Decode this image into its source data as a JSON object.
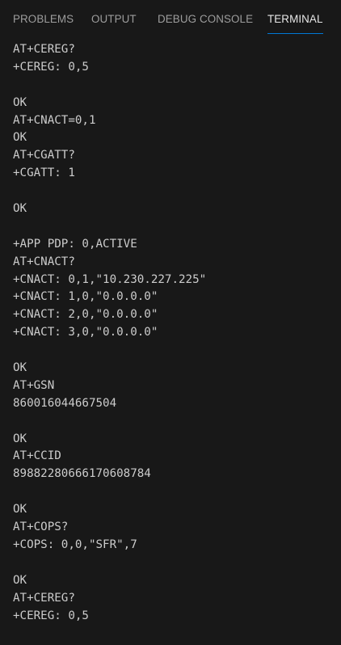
{
  "panel": {
    "tabs": [
      {
        "label": "PROBLEMS"
      },
      {
        "label": "OUTPUT"
      },
      {
        "label": "DEBUG CONSOLE"
      },
      {
        "label": "TERMINAL"
      }
    ],
    "active_tab": "TERMINAL"
  },
  "terminal": {
    "lines": [
      "AT+CEREG?",
      "+CEREG: 0,5",
      "",
      "OK",
      "AT+CNACT=0,1",
      "OK",
      "AT+CGATT?",
      "+CGATT: 1",
      "",
      "OK",
      "",
      "+APP PDP: 0,ACTIVE",
      "AT+CNACT?",
      "+CNACT: 0,1,\"10.230.227.225\"",
      "+CNACT: 1,0,\"0.0.0.0\"",
      "+CNACT: 2,0,\"0.0.0.0\"",
      "+CNACT: 3,0,\"0.0.0.0\"",
      "",
      "OK",
      "AT+GSN",
      "860016044667504",
      "",
      "OK",
      "AT+CCID",
      "89882280666170608784",
      "",
      "OK",
      "AT+COPS?",
      "+COPS: 0,0,\"SFR\",7",
      "",
      "OK",
      "AT+CEREG?",
      "+CEREG: 0,5"
    ]
  }
}
